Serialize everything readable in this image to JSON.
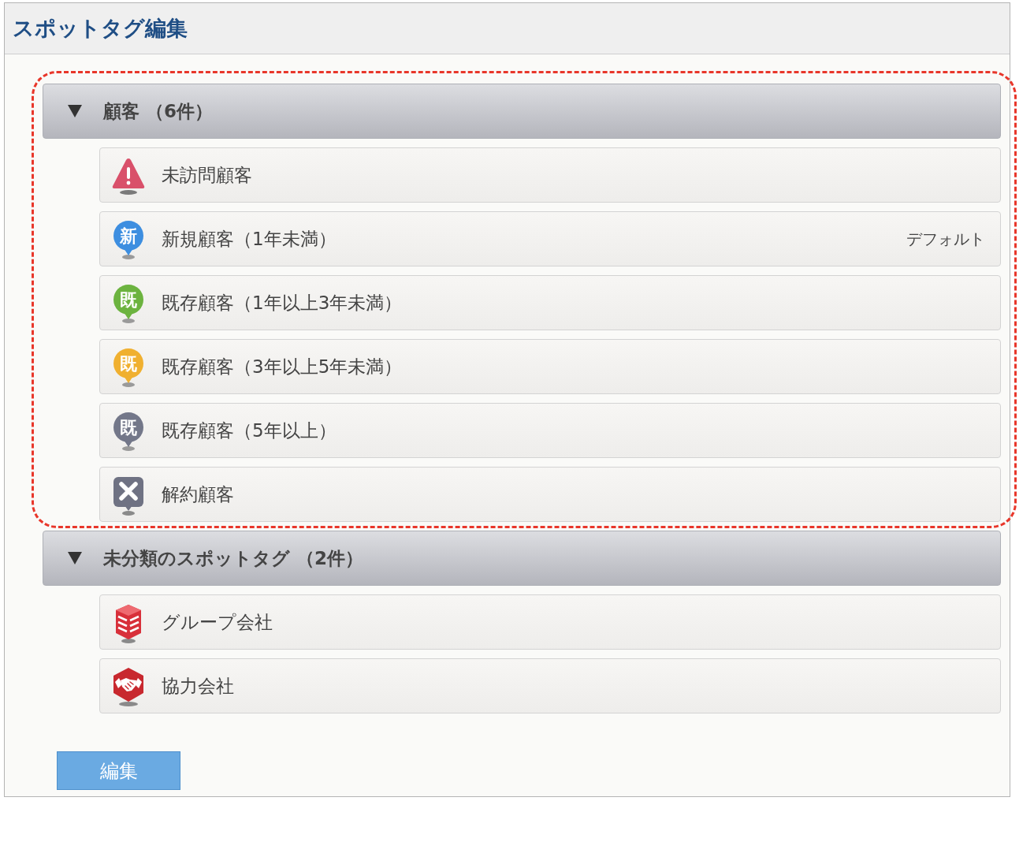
{
  "panel": {
    "title": "スポットタグ編集"
  },
  "groups": [
    {
      "title": "顧客 （6件）",
      "expanded": true,
      "highlighted": true,
      "items": [
        {
          "label": "未訪問顧客",
          "icon": {
            "kind": "warning",
            "color": "#d9506a"
          }
        },
        {
          "label": "新規顧客（1年未満）",
          "icon": {
            "kind": "pin",
            "color": "#3d8ee0",
            "glyph": "新"
          },
          "note": "デフォルト"
        },
        {
          "label": "既存顧客（1年以上3年未満）",
          "icon": {
            "kind": "pin",
            "color": "#6cb33f",
            "glyph": "既"
          }
        },
        {
          "label": "既存顧客（3年以上5年未満）",
          "icon": {
            "kind": "pin",
            "color": "#f0b030",
            "glyph": "既"
          }
        },
        {
          "label": "既存顧客（5年以上）",
          "icon": {
            "kind": "pin",
            "color": "#737789",
            "glyph": "既"
          }
        },
        {
          "label": "解約顧客",
          "icon": {
            "kind": "cross",
            "color": "#6f7283"
          }
        }
      ]
    },
    {
      "title": "未分類のスポットタグ （2件）",
      "expanded": true,
      "highlighted": false,
      "items": [
        {
          "label": "グループ会社",
          "icon": {
            "kind": "building",
            "color": "#d8303a"
          }
        },
        {
          "label": "協力会社",
          "icon": {
            "kind": "handshake",
            "color": "#c8282e"
          }
        }
      ]
    }
  ],
  "edit_button": {
    "label": "編集"
  }
}
